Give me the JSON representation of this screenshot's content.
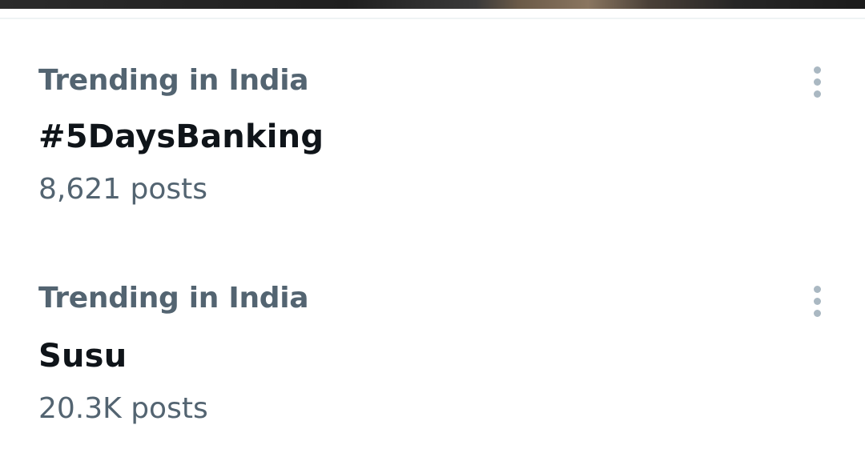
{
  "trends": [
    {
      "context": "Trending in India",
      "name": "#5DaysBanking",
      "posts": "8,621 posts",
      "more_icon": "more-vertical-icon"
    },
    {
      "context": "Trending in India",
      "name": "Susu",
      "posts": "20.3K posts",
      "more_icon": "more-vertical-icon"
    }
  ],
  "colors": {
    "primary_text": "#0f1419",
    "secondary_text": "#536471",
    "divider": "#eff3f4",
    "icon": "#aab8c2"
  }
}
